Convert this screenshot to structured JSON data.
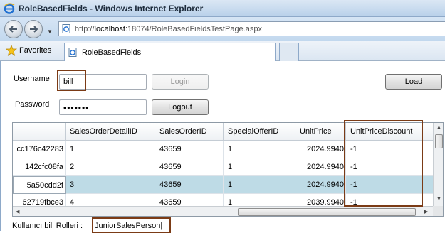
{
  "window": {
    "title": "RoleBasedFields - Windows Internet Explorer"
  },
  "address": {
    "url_prefix": "http://",
    "url_host": "localhost",
    "url_rest": ":18074/RoleBasedFieldsTestPage.aspx"
  },
  "favorites": {
    "label": "Favorites"
  },
  "tab": {
    "label": "RoleBasedFields"
  },
  "form": {
    "username_label": "Username",
    "username_value": "bill",
    "password_label": "Password",
    "password_value": "•••••••",
    "login_label": "Login",
    "logout_label": "Logout",
    "load_label": "Load"
  },
  "grid": {
    "columns": [
      "",
      "SalesOrderDetailID",
      "SalesOrderID",
      "SpecialOfferID",
      "UnitPrice",
      "UnitPriceDiscount"
    ],
    "rows": [
      {
        "id": "cc176c42283",
        "detail": "1",
        "order": "43659",
        "offer": "1",
        "price": "2024.9940",
        "discount": "-1"
      },
      {
        "id": "142cfc08fa",
        "detail": "2",
        "order": "43659",
        "offer": "1",
        "price": "2024.9940",
        "discount": "-1"
      },
      {
        "id": "5a50cdd2f",
        "detail": "3",
        "order": "43659",
        "offer": "1",
        "price": "2024.9940",
        "discount": "-1"
      },
      {
        "id": "62719fbce3",
        "detail": "4",
        "order": "43659",
        "offer": "1",
        "price": "2039.9940",
        "discount": "-1"
      }
    ],
    "selected_row": 3
  },
  "footer": {
    "prefix": "Kullanıcı bill Rolleri :",
    "role": "JuniorSalesPerson|"
  },
  "colors": {
    "highlight_border": "#7b3b16",
    "selected_row": "#bedbe6"
  },
  "icons": [
    "ie-icon",
    "back-icon",
    "forward-icon",
    "page-icon",
    "star-icon",
    "tab-page-icon"
  ]
}
